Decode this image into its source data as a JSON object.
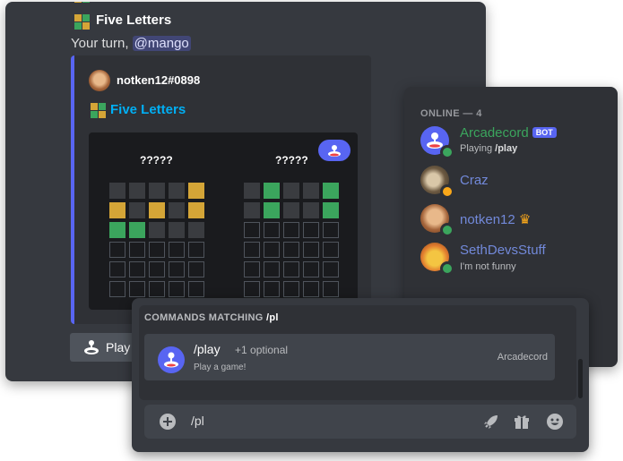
{
  "chat": {
    "game_title": "Five Letters",
    "turn_text": "Your turn, ",
    "mention": "@mango",
    "embed": {
      "author": "notken12#0898",
      "title": "Five Letters",
      "board": {
        "left_title": "?????",
        "right_title": "?????",
        "left_rows": [
          [
            "gray",
            "gray",
            "gray",
            "gray",
            "yellow"
          ],
          [
            "yellow",
            "gray",
            "yellow",
            "gray",
            "yellow"
          ],
          [
            "green",
            "green",
            "gray",
            "gray",
            "gray"
          ],
          [
            "empty",
            "empty",
            "empty",
            "empty",
            "empty"
          ],
          [
            "empty",
            "empty",
            "empty",
            "empty",
            "empty"
          ],
          [
            "empty",
            "empty",
            "empty",
            "empty",
            "empty"
          ]
        ],
        "right_rows": [
          [
            "gray",
            "green",
            "gray",
            "gray",
            "green"
          ],
          [
            "gray",
            "green",
            "gray",
            "gray",
            "green"
          ],
          [
            "empty",
            "empty",
            "empty",
            "empty",
            "empty"
          ],
          [
            "empty",
            "empty",
            "empty",
            "empty",
            "empty"
          ],
          [
            "empty",
            "empty",
            "empty",
            "empty",
            "empty"
          ],
          [
            "empty",
            "empty",
            "empty",
            "empty",
            "empty"
          ]
        ]
      }
    },
    "play_button": "Play"
  },
  "members": {
    "header": "ONLINE — 4",
    "list": [
      {
        "name": "Arcadecord",
        "badge": "BOT",
        "sub_prefix": "Playing ",
        "sub_bold": "/play",
        "name_color": "#3ba55d",
        "status": "online"
      },
      {
        "name": "Craz",
        "name_color": "#7289da",
        "status": "idle"
      },
      {
        "name": "notken12",
        "crown": "♛",
        "name_color": "#7289da",
        "status": "online"
      },
      {
        "name": "SethDevsStuff",
        "sub": "I'm not funny",
        "name_color": "#7289da",
        "status": "online"
      }
    ]
  },
  "commands": {
    "header_prefix": "COMMANDS MATCHING ",
    "header_query": "/pl",
    "item": {
      "name": "/play",
      "optional": "+1 optional",
      "description": "Play a game!",
      "app": "Arcadecord"
    }
  },
  "input": {
    "value": "/pl"
  },
  "icons": {
    "add": "plus-circle-icon",
    "rocket": "rocket-icon",
    "gift": "gift-icon",
    "emoji": "emoji-smile-icon"
  },
  "colors": {
    "brand": "#5865f2",
    "green": "#3ba55d",
    "yellow": "#d4a537",
    "link": "#00aff4"
  }
}
